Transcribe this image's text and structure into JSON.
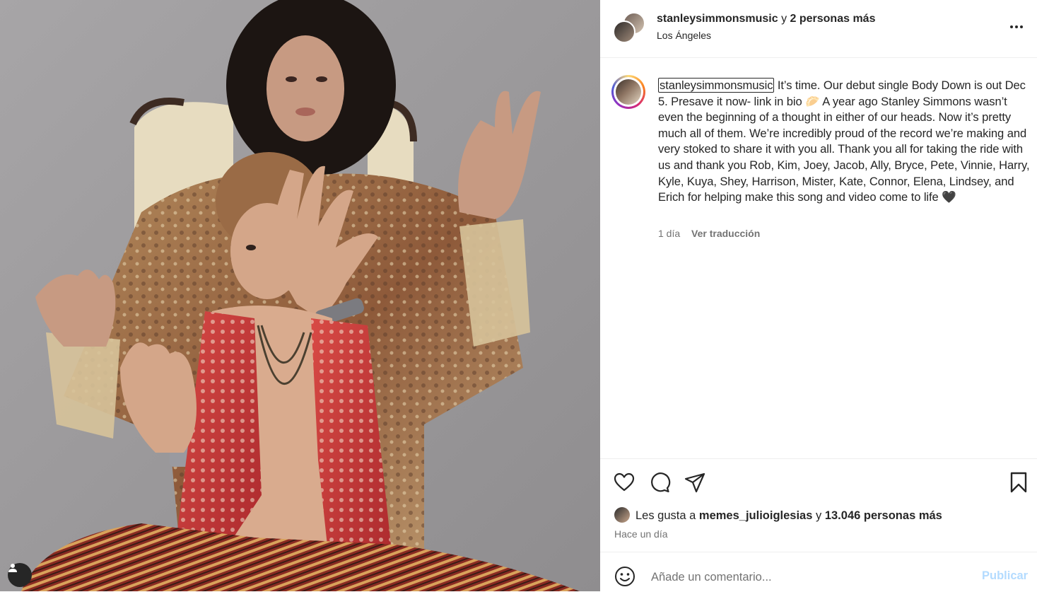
{
  "post": {
    "photo_alt": "Two musicians in patterned robes posing with raised hands",
    "tag_icon": "user-tag-icon"
  },
  "header": {
    "username": "stanleysimmonsmusic",
    "joiner": " y ",
    "others": "2 personas más",
    "location": "Los Ángeles",
    "more_icon": "more-horizontal-icon"
  },
  "caption": {
    "username": "stanleysimmonsmusic",
    "text_1": " It’s time. Our debut single Body Down is out Dec 5. Presave it now- link in bio ",
    "emoji_1": "🥟",
    "text_2": " A year ago Stanley Simmons wasn’t even the beginning of a thought in either of our heads. Now it’s pretty much all of them. We’re incredibly proud of the record we’re making and very stoked to share it with you all. Thank you all for taking the ride with us and thank you Rob, Kim, Joey, Jacob, Ally, Bryce, Pete, Vinnie, Harry, Kyle, Kuya, Shey, Harrison, Mister, Kate, Connor, Elena, Lindsey, and Erich for helping make this song and video come to life ",
    "emoji_2": "🖤",
    "time": "1 día",
    "translate": "Ver traducción"
  },
  "actions": {
    "like_icon": "heart-icon",
    "comment_icon": "comment-icon",
    "share_icon": "share-icon",
    "save_icon": "bookmark-icon"
  },
  "likes": {
    "prefix": "Les gusta a ",
    "user": "memes_julioiglesias",
    "joiner": " y ",
    "count_text": "13.046 personas más",
    "ago": "Hace un día"
  },
  "comment_box": {
    "placeholder": "Añade un comentario...",
    "value": "",
    "publish": "Publicar",
    "emoji_icon": "smiley-icon"
  },
  "colors": {
    "text": "#262626",
    "muted": "#737373",
    "publish_disabled": "#b3dbff",
    "border": "#efefef"
  }
}
